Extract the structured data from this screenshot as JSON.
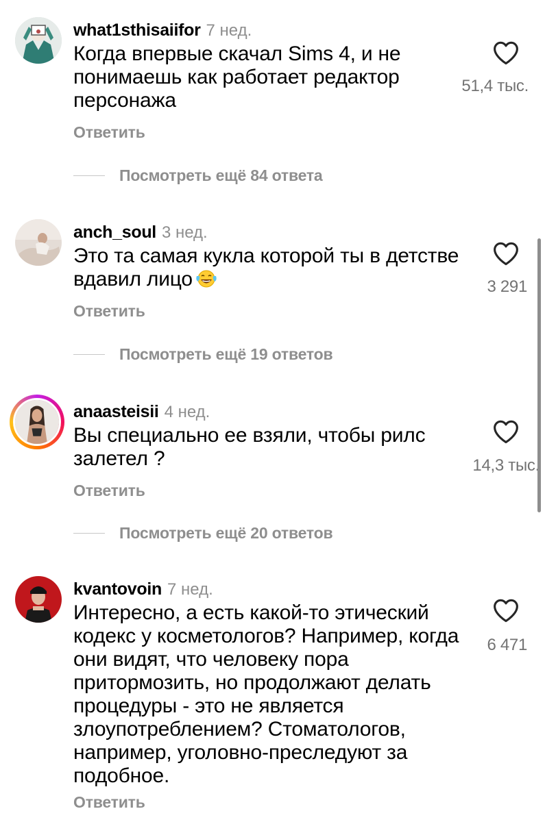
{
  "comments": [
    {
      "username": "what1sthisaiifor",
      "time": "7 нед.",
      "text": "Когда впервые скачал Sims 4, и не понимаешь как работает редактор персонажа",
      "likes": "51,4 тыс.",
      "reply_label": "Ответить",
      "more_replies": "Посмотреть ещё 84 ответа"
    },
    {
      "username": "anch_soul",
      "time": "3 нед.",
      "text": "Это та самая кукла которой ты в детстве вдавил лицо",
      "emoji": "face-with-tears-of-joy-emoji",
      "likes": "3 291",
      "reply_label": "Ответить",
      "more_replies": "Посмотреть ещё 19 ответов"
    },
    {
      "username": "anaasteisii",
      "time": "4 нед.",
      "text": "Вы специально ее взяли, чтобы рилс залетел ?",
      "likes": "14,3 тыс.",
      "reply_label": "Ответить",
      "more_replies": "Посмотреть ещё 20 ответов",
      "has_story_ring": true
    },
    {
      "username": "kvantovoin",
      "time": "7 нед.",
      "text": "Интересно, а есть какой-то этический кодекс у косметологов? Например, когда они видят, что человеку пора притормозить, но продолжают делать процедуры - это не является злоупотреблением? Стоматологов, например, уголовно-преследуют за подобное.",
      "likes": "6 471",
      "reply_label": "Ответить"
    }
  ],
  "icons": {
    "like": "heart-outline-icon"
  },
  "colors": {
    "secondary_text": "#8e8e8e",
    "story_ring_start": "#c41ee3",
    "story_ring_end": "#ffc21a"
  }
}
